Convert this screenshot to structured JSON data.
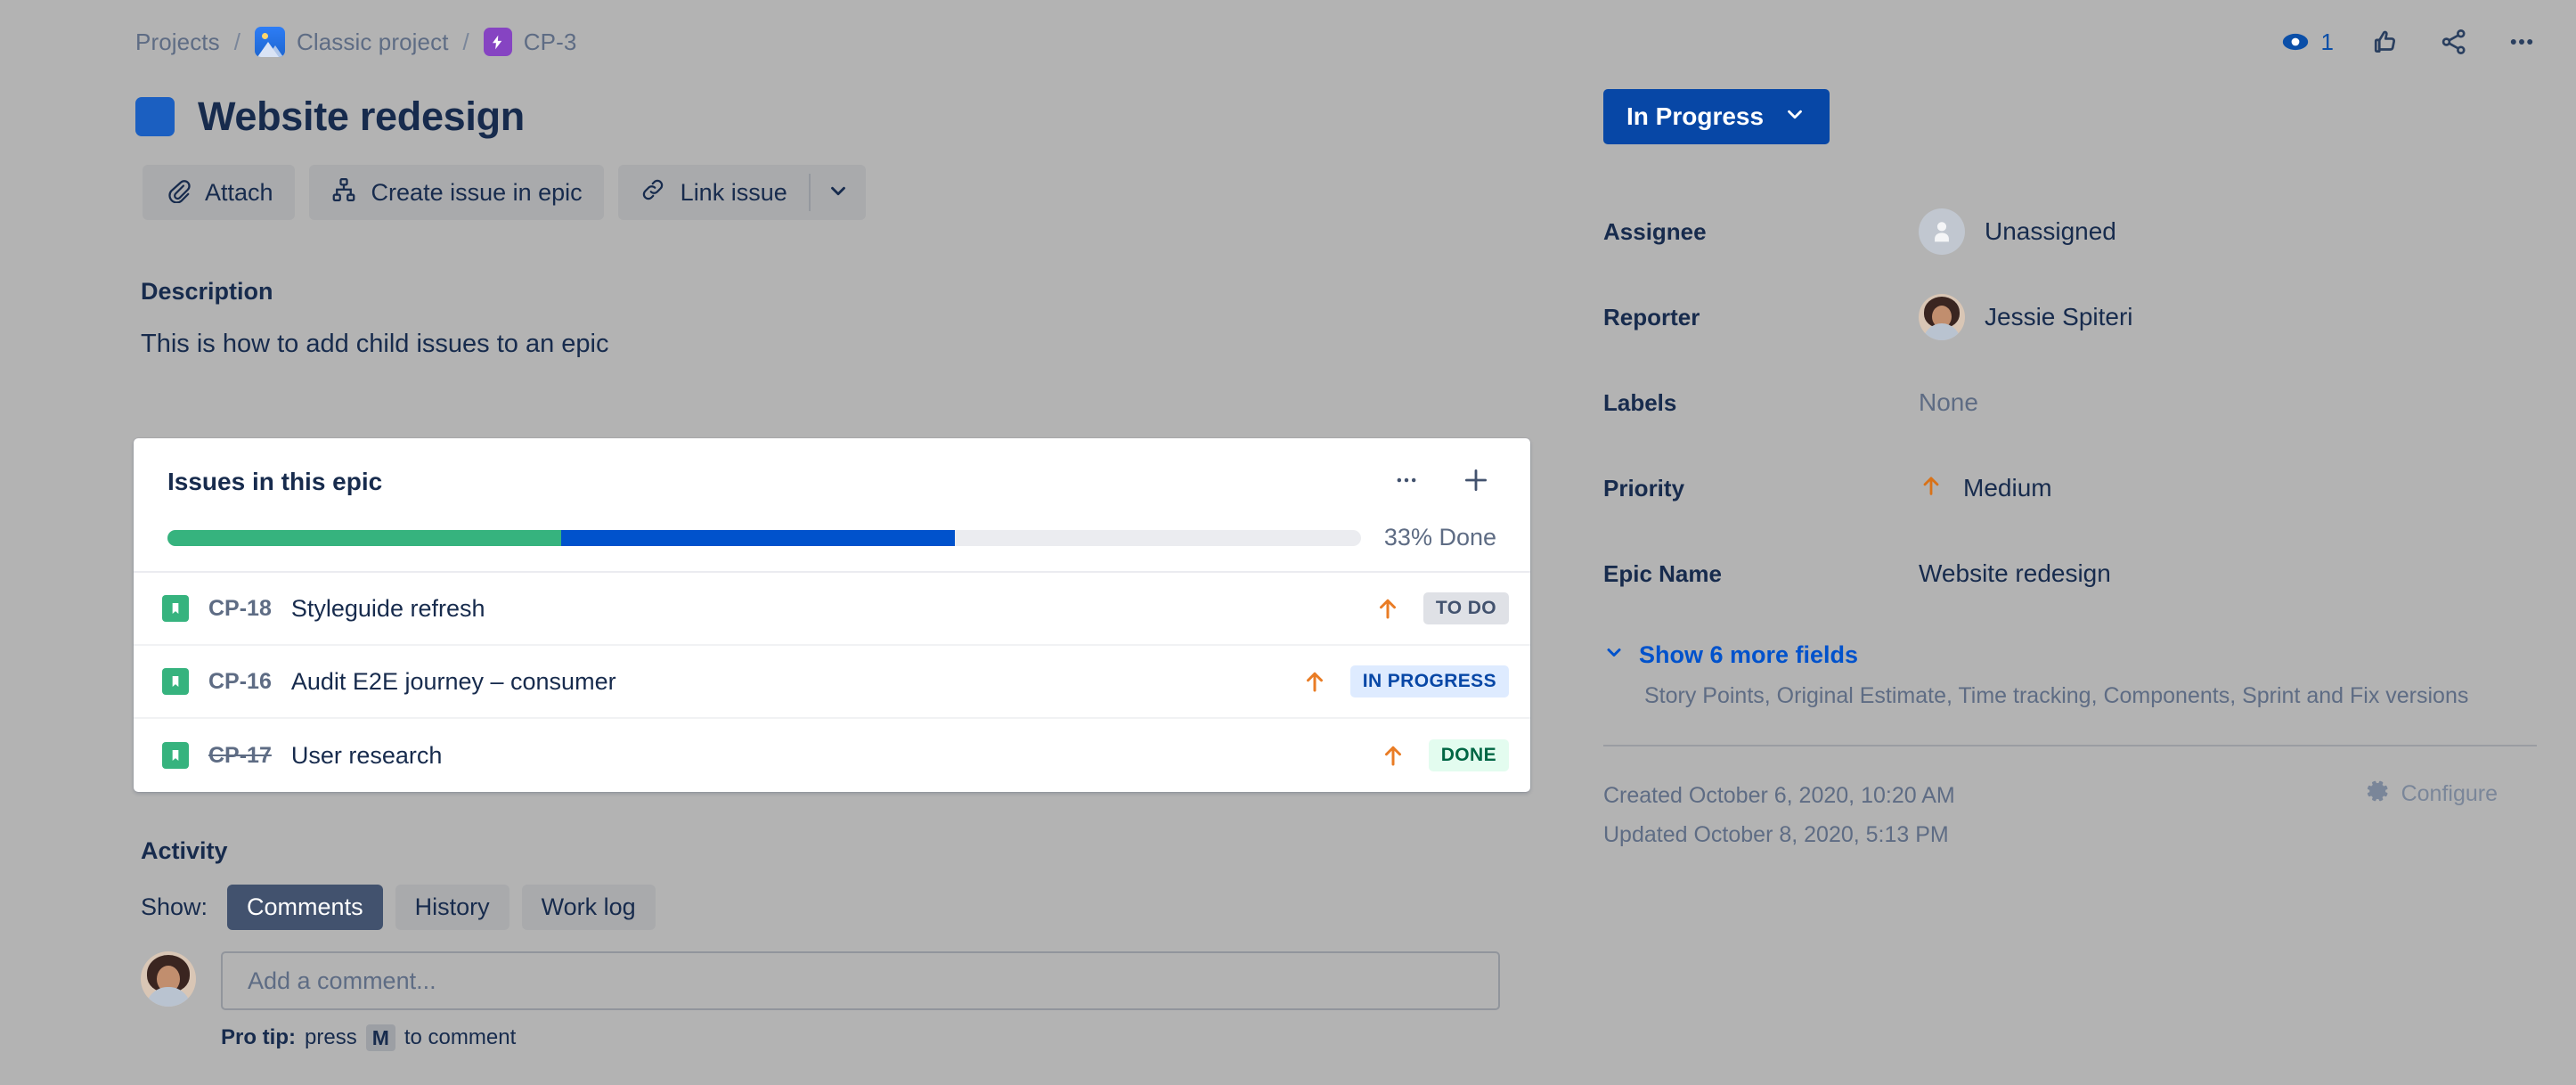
{
  "breadcrumb": {
    "projects_label": "Projects",
    "separator": "/",
    "project_label": "Classic project",
    "issue_key": "CP-3",
    "project_icon": "project-image-icon",
    "epic_icon": "epic-bolt-icon"
  },
  "top_actions": {
    "watch_icon": "eye-icon",
    "watch_count": "1",
    "like_icon": "thumbs-up-icon",
    "share_icon": "share-icon",
    "more_icon": "more-ellipsis-icon"
  },
  "header": {
    "epic_color": "#1B5FC1",
    "title": "Website redesign"
  },
  "actions": {
    "attach_label": "Attach",
    "attach_icon": "paperclip-icon",
    "create_issue_label": "Create issue in epic",
    "create_issue_icon": "hierarchy-icon",
    "link_issue_label": "Link issue",
    "link_issue_icon": "chain-link-icon",
    "dropdown_icon": "chevron-down-icon"
  },
  "description": {
    "heading": "Description",
    "text": "This is how to add child issues to an epic"
  },
  "epic_panel": {
    "title": "Issues in this epic",
    "more_icon": "more-ellipsis-icon",
    "add_icon": "plus-icon",
    "progress": {
      "done_percent": 33,
      "in_progress_percent": 33,
      "label": "33% Done",
      "done_color": "#36B37E",
      "in_progress_color": "#0052CC",
      "track_color": "#EBECF0"
    },
    "issues": [
      {
        "type_icon": "story-icon",
        "key": "CP-18",
        "key_struck": false,
        "summary": "Styleguide refresh",
        "priority_icon": "priority-medium-up-arrow",
        "status": "TO DO",
        "status_bg": "#DFE1E6",
        "status_color": "#42526E"
      },
      {
        "type_icon": "story-icon",
        "key": "CP-16",
        "key_struck": false,
        "summary": "Audit E2E journey – consumer",
        "priority_icon": "priority-medium-up-arrow",
        "status": "IN PROGRESS",
        "status_bg": "#DEEBFF",
        "status_color": "#0747A6"
      },
      {
        "type_icon": "story-icon",
        "key": "CP-17",
        "key_struck": true,
        "summary": "User research",
        "priority_icon": "priority-medium-up-arrow",
        "status": "DONE",
        "status_bg": "#E3FCEF",
        "status_color": "#006644"
      }
    ]
  },
  "activity": {
    "heading": "Activity",
    "show_label": "Show:",
    "tabs": [
      {
        "label": "Comments",
        "active": true
      },
      {
        "label": "History",
        "active": false
      },
      {
        "label": "Work log",
        "active": false
      }
    ],
    "comment_placeholder": "Add a comment...",
    "protip_prefix": "Pro tip:",
    "protip_press": "press",
    "protip_key": "M",
    "protip_suffix": "to comment"
  },
  "sidebar": {
    "status": {
      "label": "In Progress",
      "chevron_icon": "chevron-down-icon",
      "bg_color": "#0747A6"
    },
    "fields": [
      {
        "label": "Assignee",
        "value": "Unassigned",
        "avatar": "unassigned-avatar-icon"
      },
      {
        "label": "Reporter",
        "value": "Jessie Spiteri",
        "avatar": "reporter-avatar-photo"
      },
      {
        "label": "Labels",
        "value": "None",
        "muted": true
      },
      {
        "label": "Priority",
        "value": "Medium",
        "icon": "priority-medium-up-arrow"
      },
      {
        "label": "Epic Name",
        "value": "Website redesign"
      }
    ],
    "more_fields": {
      "chevron_icon": "chevron-down-icon",
      "link_label": "Show 6 more fields",
      "description": "Story Points, Original Estimate, Time tracking, Components, Sprint and Fix versions"
    },
    "meta": {
      "created": "Created October 6, 2020, 10:20 AM",
      "updated": "Updated October 8, 2020, 5:13 PM",
      "configure_label": "Configure",
      "configure_icon": "gear-icon"
    }
  }
}
